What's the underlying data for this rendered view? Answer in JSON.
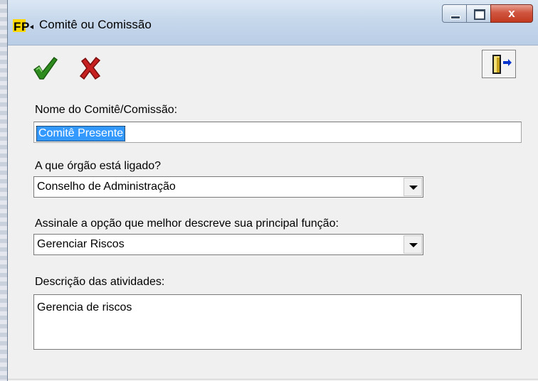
{
  "window": {
    "title": "Comitê ou Comissão",
    "app_icon": "fp-logo"
  },
  "titlebar_buttons": {
    "minimize_icon": "minimize-icon",
    "maximize_icon": "maximize-icon",
    "close_label": "x"
  },
  "toolbar": {
    "confirm_icon": "checkmark-icon",
    "cancel_icon": "x-mark-icon",
    "exit_icon": "exit-door-icon",
    "colors": {
      "confirm": "#2e8b1e",
      "cancel": "#c62020",
      "exit": "#0033cc"
    }
  },
  "form": {
    "name_label": "Nome do Comitê/Comissão:",
    "name_value": "Comitê Presente",
    "organ_label": "A que órgão está ligado?",
    "organ_value": "Conselho de Administração",
    "function_label": "Assinale a opção que melhor descreve sua principal função:",
    "function_value": "Gerenciar Riscos",
    "activities_label": "Descrição das atividades:",
    "activities_value": "Gerencia de riscos"
  },
  "colors": {
    "selection": "#3399ff",
    "close_button": "#c8442a"
  }
}
